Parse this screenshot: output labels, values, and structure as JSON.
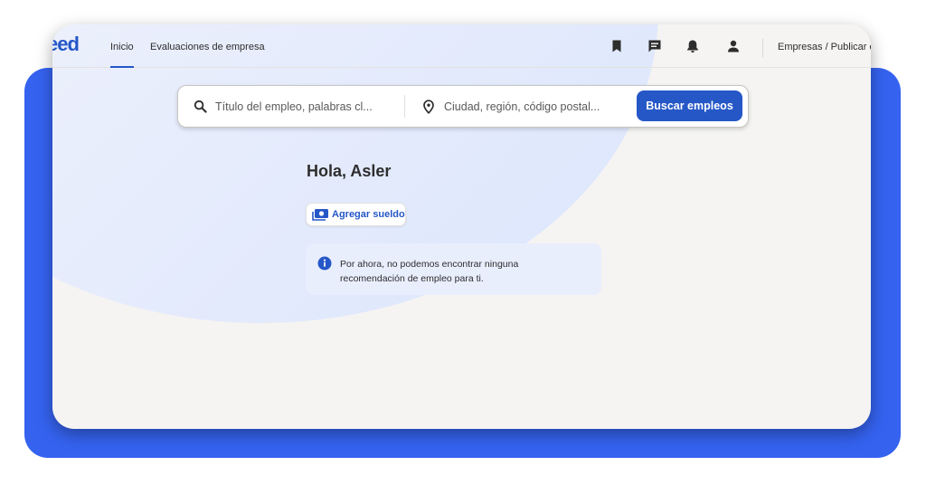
{
  "brand": {
    "logo_text": "eed",
    "color": "#2557c7"
  },
  "nav": {
    "links": [
      {
        "label": "Inicio",
        "active": true
      },
      {
        "label": "Evaluaciones de empresa",
        "active": false
      }
    ],
    "icons": [
      "bookmark-icon",
      "chat-icon",
      "bell-icon",
      "user-icon"
    ],
    "right_link": "Empresas / Publicar e"
  },
  "search": {
    "what_placeholder": "Título del empleo, palabras cl...",
    "what_value": "",
    "where_placeholder": "Ciudad, región, código postal...",
    "where_value": "",
    "button_label": "Buscar empleos"
  },
  "greeting": "Hola, Asler",
  "salary_button": "Agregar sueldo",
  "info_message": "Por ahora, no podemos encontrar ninguna recomendación de empleo para ti.",
  "colors": {
    "frame_blue": "#3563f0",
    "accent": "#2557c7",
    "info_bg": "#e9eefd"
  }
}
